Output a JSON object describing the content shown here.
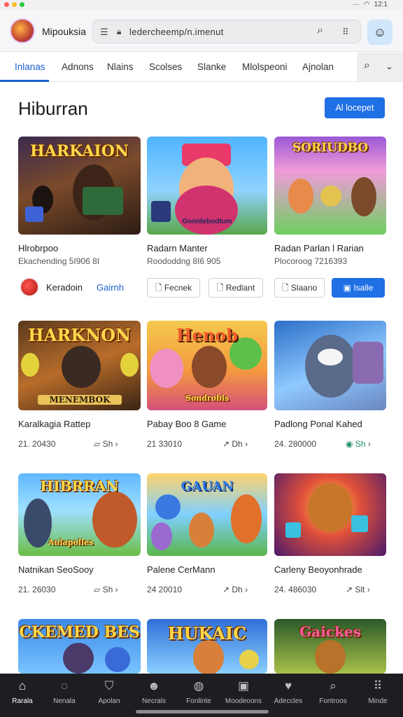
{
  "status": {
    "time": "12:1",
    "signal": "···"
  },
  "app": {
    "name": "Mipouksia"
  },
  "urlbar": {
    "url": "ledercheemp/n.imenut"
  },
  "tabs": [
    {
      "label": "Inlanas"
    },
    {
      "label": "Adnons"
    },
    {
      "label": "Nlains"
    },
    {
      "label": "Scolses"
    },
    {
      "label": "Slanke"
    },
    {
      "label": "Mlolspeoni"
    },
    {
      "label": "Ajnolan"
    }
  ],
  "section": {
    "title": "Hiburran",
    "action_label": "Al locepet"
  },
  "featured": [
    {
      "banner": "HARKAION",
      "title": "Hlrobrpoo",
      "subtitle": "Ekachending 5I906 8I"
    },
    {
      "banner": "Gonidebodtum",
      "title": "Radarn Manter",
      "subtitle": "Roododdng 8I6 905"
    },
    {
      "banner": "SORIUDBO",
      "title": "Radan Parlan l Rarian",
      "subtitle": "Plocoroog 7216393"
    }
  ],
  "publisher": {
    "name": "Keradoin",
    "link": "Gairnh",
    "buttons": [
      "Fecnek",
      "Redlant",
      "Slaano",
      "Isalle"
    ]
  },
  "grid": [
    {
      "banner": "HARKNON",
      "title": "Karalkagia Rattep",
      "number": "21. 20430",
      "action": "Sh"
    },
    {
      "banner": "Henob",
      "title": "Pabay Boo 8 Game",
      "number": "21 33010",
      "action": "Dh"
    },
    {
      "banner": "",
      "title": "Padlong Ponal Kahed",
      "number": "24. 280000",
      "action": "Sh"
    },
    {
      "banner": "HIBRRAN",
      "title": "Natnikan SeoSooy",
      "number": "21. 26030",
      "action": "Sh"
    },
    {
      "banner": "GAUAN",
      "title": "Palene CerMann",
      "number": "24 20010",
      "action": "Dh"
    },
    {
      "banner": "",
      "title": "Carleny Beoyonhrade",
      "number": "24. 486030",
      "action": "Slt"
    },
    {
      "banner": "CKEMED BES",
      "title": "",
      "number": "",
      "action": ""
    },
    {
      "banner": "HUKAIC",
      "title": "",
      "number": "",
      "action": ""
    },
    {
      "banner": "Gaickes",
      "title": "",
      "number": "",
      "action": ""
    }
  ],
  "bottom_nav": [
    {
      "label": "Rarala",
      "icon": "home-icon"
    },
    {
      "label": "Nenala",
      "icon": "chat-icon"
    },
    {
      "label": "Apolan",
      "icon": "shield-icon"
    },
    {
      "label": "Necrals",
      "icon": "profile-icon"
    },
    {
      "label": "Fonlinte",
      "icon": "globe-icon"
    },
    {
      "label": "Moodeoons",
      "icon": "box-icon"
    },
    {
      "label": "Adeccles",
      "icon": "heart-icon"
    },
    {
      "label": "Fontroos",
      "icon": "search-icon"
    },
    {
      "label": "Minde",
      "icon": "grid-icon"
    }
  ],
  "colors": {
    "accent": "#1f6fe5",
    "nav_bg": "#1e1e22",
    "tab_active": "#1a5fd0"
  }
}
